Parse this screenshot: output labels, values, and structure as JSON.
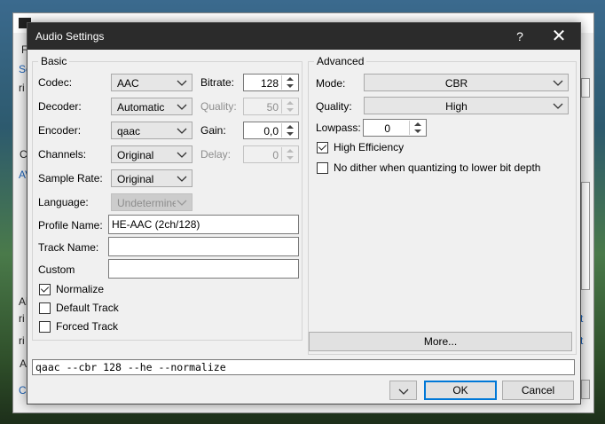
{
  "dialog": {
    "title": "Audio Settings",
    "help_glyph": "?",
    "close_glyph": "✕"
  },
  "basic": {
    "group_title": "Basic",
    "codec": {
      "label": "Codec:",
      "value": "AAC"
    },
    "decoder": {
      "label": "Decoder:",
      "value": "Automatic"
    },
    "encoder": {
      "label": "Encoder:",
      "value": "qaac"
    },
    "channels": {
      "label": "Channels:",
      "value": "Original"
    },
    "sample_rate": {
      "label": "Sample Rate:",
      "value": "Original"
    },
    "language": {
      "label": "Language:",
      "value": "Undetermined"
    },
    "bitrate": {
      "label": "Bitrate:",
      "value": "128"
    },
    "quality": {
      "label": "Quality:",
      "value": "50"
    },
    "gain": {
      "label": "Gain:",
      "value": "0,0"
    },
    "delay": {
      "label": "Delay:",
      "value": "0"
    },
    "profile_name": {
      "label": "Profile Name:",
      "value": "HE-AAC (2ch/128)"
    },
    "track_name": {
      "label": "Track Name:",
      "value": ""
    },
    "custom": {
      "label": "Custom",
      "value": ""
    },
    "normalize": {
      "label": "Normalize",
      "checked": true
    },
    "default_track": {
      "label": "Default Track",
      "checked": false
    },
    "forced_track": {
      "label": "Forced Track",
      "checked": false
    }
  },
  "advanced": {
    "group_title": "Advanced",
    "mode": {
      "label": "Mode:",
      "value": "CBR"
    },
    "quality": {
      "label": "Quality:",
      "value": "High"
    },
    "lowpass": {
      "label": "Lowpass:",
      "value": "0"
    },
    "high_efficiency": {
      "label": "High Efficiency",
      "checked": true
    },
    "no_dither": {
      "label": "No dither when quantizing to lower bit depth",
      "checked": false
    },
    "more_button": "More..."
  },
  "command_line": "qaac --cbr 128 --he --normalize",
  "footer": {
    "menu_button": "⌵",
    "ok": "OK",
    "cancel": "Cancel"
  },
  "background": {
    "fragments": [
      "F",
      "Sc",
      "ri",
      "C",
      "AV",
      "Ai",
      "ri",
      "ri",
      "A",
      "C",
      "t",
      "t"
    ]
  }
}
